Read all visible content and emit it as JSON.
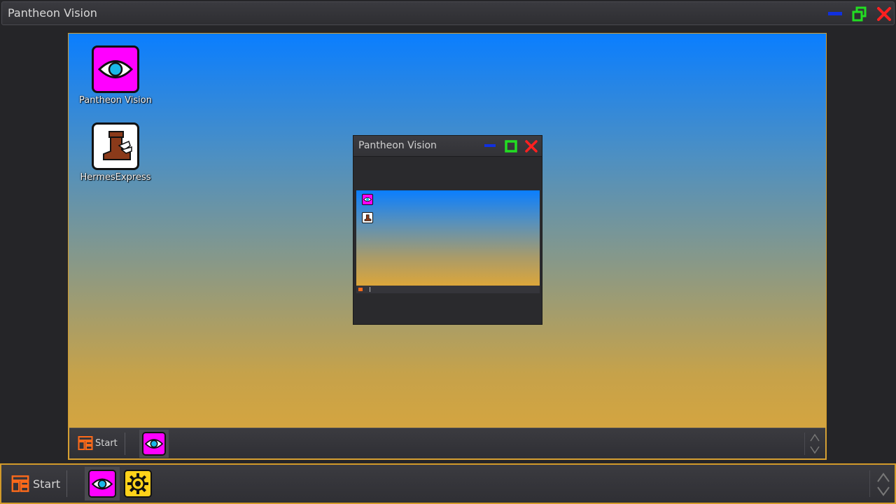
{
  "window": {
    "title": "Pantheon Vision",
    "controls": {
      "minimize_icon": "minimize-icon",
      "restore_icon": "restore-icon",
      "close_icon": "close-icon"
    }
  },
  "desktop": {
    "icons": [
      {
        "label": "Pantheon Vision",
        "icon": "eye-icon",
        "bg": "#ff00ff"
      },
      {
        "label": "HermesExpress",
        "icon": "winged-boot-icon",
        "bg": "#ffffff"
      }
    ],
    "window": {
      "title": "Pantheon Vision",
      "controls": {
        "minimize_icon": "minimize-icon",
        "maximize_icon": "maximize-icon",
        "close_icon": "close-icon"
      }
    },
    "taskbar": {
      "start_label": "Start",
      "apps": [
        {
          "name": "Pantheon Vision",
          "icon": "eye-icon",
          "active": true
        }
      ]
    }
  },
  "taskbar": {
    "start_label": "Start",
    "apps": [
      {
        "name": "Pantheon Vision",
        "icon": "eye-icon",
        "active": true
      },
      {
        "name": "Settings",
        "icon": "gear-icon",
        "active": false
      }
    ]
  },
  "colors": {
    "accent": "#d29a2a",
    "start_orange": "#ff6a1a",
    "minimize_blue": "#1030e0",
    "maximize_green": "#22dd22",
    "close_red": "#ff2020"
  }
}
